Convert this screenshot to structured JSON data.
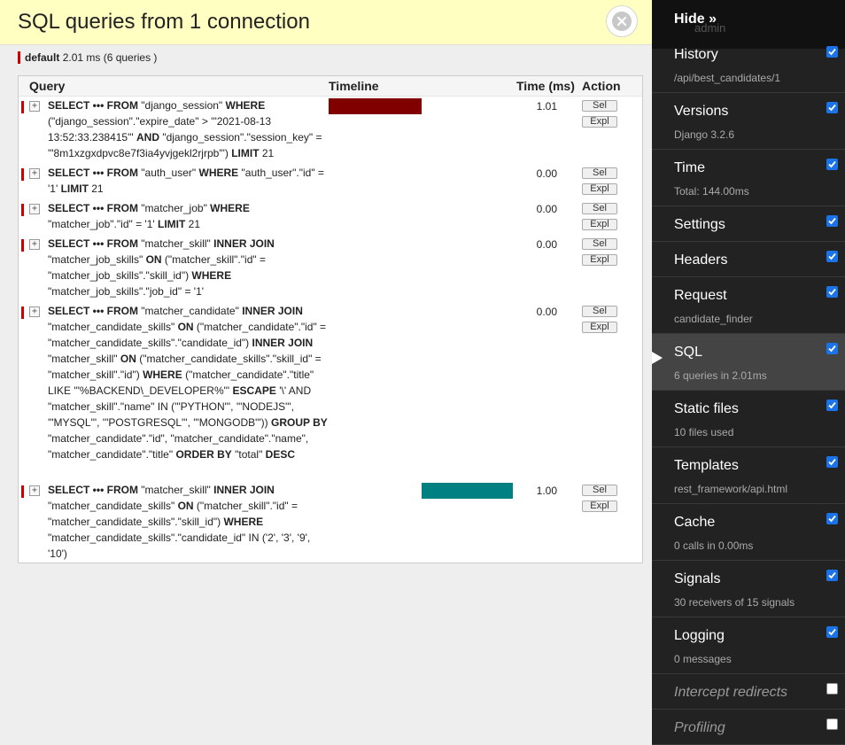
{
  "panel": {
    "title": "SQL queries from 1 connection",
    "connection": {
      "name": "default",
      "summary": "2.01 ms (6 queries )"
    }
  },
  "table": {
    "headers": {
      "query": "Query",
      "timeline": "Timeline",
      "time": "Time (ms)",
      "action": "Action"
    },
    "sel_label": "Sel",
    "expl_label": "Expl",
    "toggle_symbol": "+",
    "rows": [
      {
        "time": "1.01",
        "timeline_color": "#800000"
      },
      {
        "time": "0.00"
      },
      {
        "time": "0.00"
      },
      {
        "time": "0.00"
      },
      {
        "time": "0.00"
      },
      {
        "time": "1.00",
        "timeline_color": "#008080"
      }
    ]
  },
  "toolbar": {
    "hide_label": "Hide »",
    "ghost_text": "admin",
    "items": [
      {
        "title": "History",
        "sub": "/api/best_candidates/1",
        "checked": true
      },
      {
        "title": "Versions",
        "sub": "Django 3.2.6",
        "checked": true
      },
      {
        "title": "Time",
        "sub": "Total: 144.00ms",
        "checked": true
      },
      {
        "title": "Settings",
        "checked": true
      },
      {
        "title": "Headers",
        "checked": true
      },
      {
        "title": "Request",
        "sub": "candidate_finder",
        "checked": true
      },
      {
        "title": "SQL",
        "sub": "6 queries in 2.01ms",
        "checked": true,
        "active": true
      },
      {
        "title": "Static files",
        "sub": "10 files used",
        "checked": true
      },
      {
        "title": "Templates",
        "sub": "rest_framework/api.html",
        "checked": true
      },
      {
        "title": "Cache",
        "sub": "0 calls in 0.00ms",
        "checked": true
      },
      {
        "title": "Signals",
        "sub": "30 receivers of 15 signals",
        "checked": true
      },
      {
        "title": "Logging",
        "sub": "0 messages",
        "checked": true
      },
      {
        "title": "Intercept redirects",
        "checked": false
      },
      {
        "title": "Profiling",
        "checked": false
      }
    ]
  },
  "colors": {
    "accent": "#cc0000",
    "checkbox": "#1a73e8",
    "header_bg": "#ffffc2",
    "toolbar_bg": "#222222"
  }
}
